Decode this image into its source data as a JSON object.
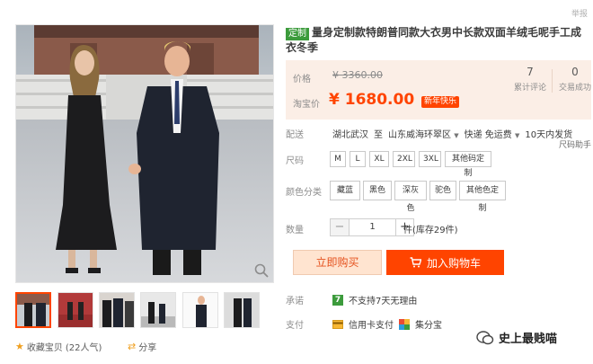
{
  "header": {
    "report": "举报"
  },
  "product": {
    "custom_tag": "定制",
    "title": "量身定制款特朗普同款大衣男中长款双面羊绒毛呢手工成衣冬季"
  },
  "price": {
    "price_label": "价格",
    "old_price": "¥ 3360.00",
    "taobao_label": "淘宝价",
    "new_price": "¥ 1680.00",
    "promo_tag": "新年快乐"
  },
  "stats": [
    {
      "num": "7",
      "label": "累计评论"
    },
    {
      "num": "0",
      "label": "交易成功"
    }
  ],
  "shipping": {
    "label": "配送",
    "from": "湖北武汉",
    "to_word": "至",
    "to": "山东威海环翠区",
    "method": "快递 免运费",
    "delivery": "10天内发货"
  },
  "size": {
    "label": "尺码",
    "help": "尺码助手",
    "options": [
      "M",
      "L",
      "XL",
      "2XL",
      "3XL",
      "其他码定制"
    ]
  },
  "color": {
    "label": "颜色分类",
    "options": [
      "藏蓝",
      "黑色",
      "深灰色",
      "驼色",
      "其他色定制"
    ]
  },
  "quantity": {
    "label": "数量",
    "minus": "−",
    "value": "1",
    "plus": "+",
    "stock": "件(库存29件)"
  },
  "actions": {
    "buy": "立即购买",
    "cart": "加入购物车"
  },
  "promise": {
    "label": "承诺",
    "badge": "7",
    "text": "不支持7天无理由"
  },
  "payment": {
    "label": "支付",
    "credit": "信用卡支付",
    "huabei": "集分宝"
  },
  "gallery": {
    "favorite": "收藏宝贝",
    "popularity": "(22人气)",
    "share": "分享"
  },
  "watermark": {
    "text": "史上最贱喵"
  },
  "colors": {
    "accent": "#ff4400",
    "price_bg": "#fbeee6",
    "buy_bg": "#ffe4d0",
    "green": "#3c9b3c"
  }
}
